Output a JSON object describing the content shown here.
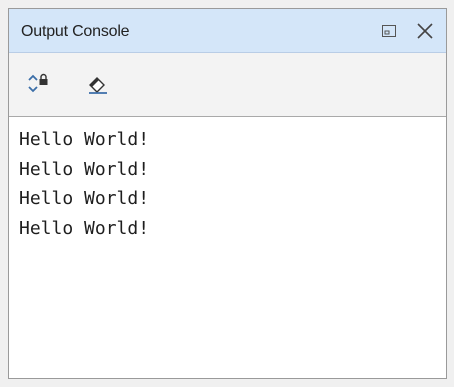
{
  "panel": {
    "title": "Output Console"
  },
  "titlebar_controls": [
    {
      "icon": "restore-icon"
    },
    {
      "icon": "close-icon"
    }
  ],
  "toolbar": {
    "tools": [
      {
        "icon": "scroll-lock-icon"
      },
      {
        "icon": "eraser-clear-icon"
      }
    ]
  },
  "console": {
    "lines": [
      "Hello World!",
      "Hello World!",
      "Hello World!",
      "Hello World!"
    ]
  },
  "colors": {
    "titlebar_bg": "#d4e6f9",
    "toolbar_bg": "#f3f3f3",
    "console_bg": "#ffffff",
    "icon_blue": "#3b6ea8"
  }
}
